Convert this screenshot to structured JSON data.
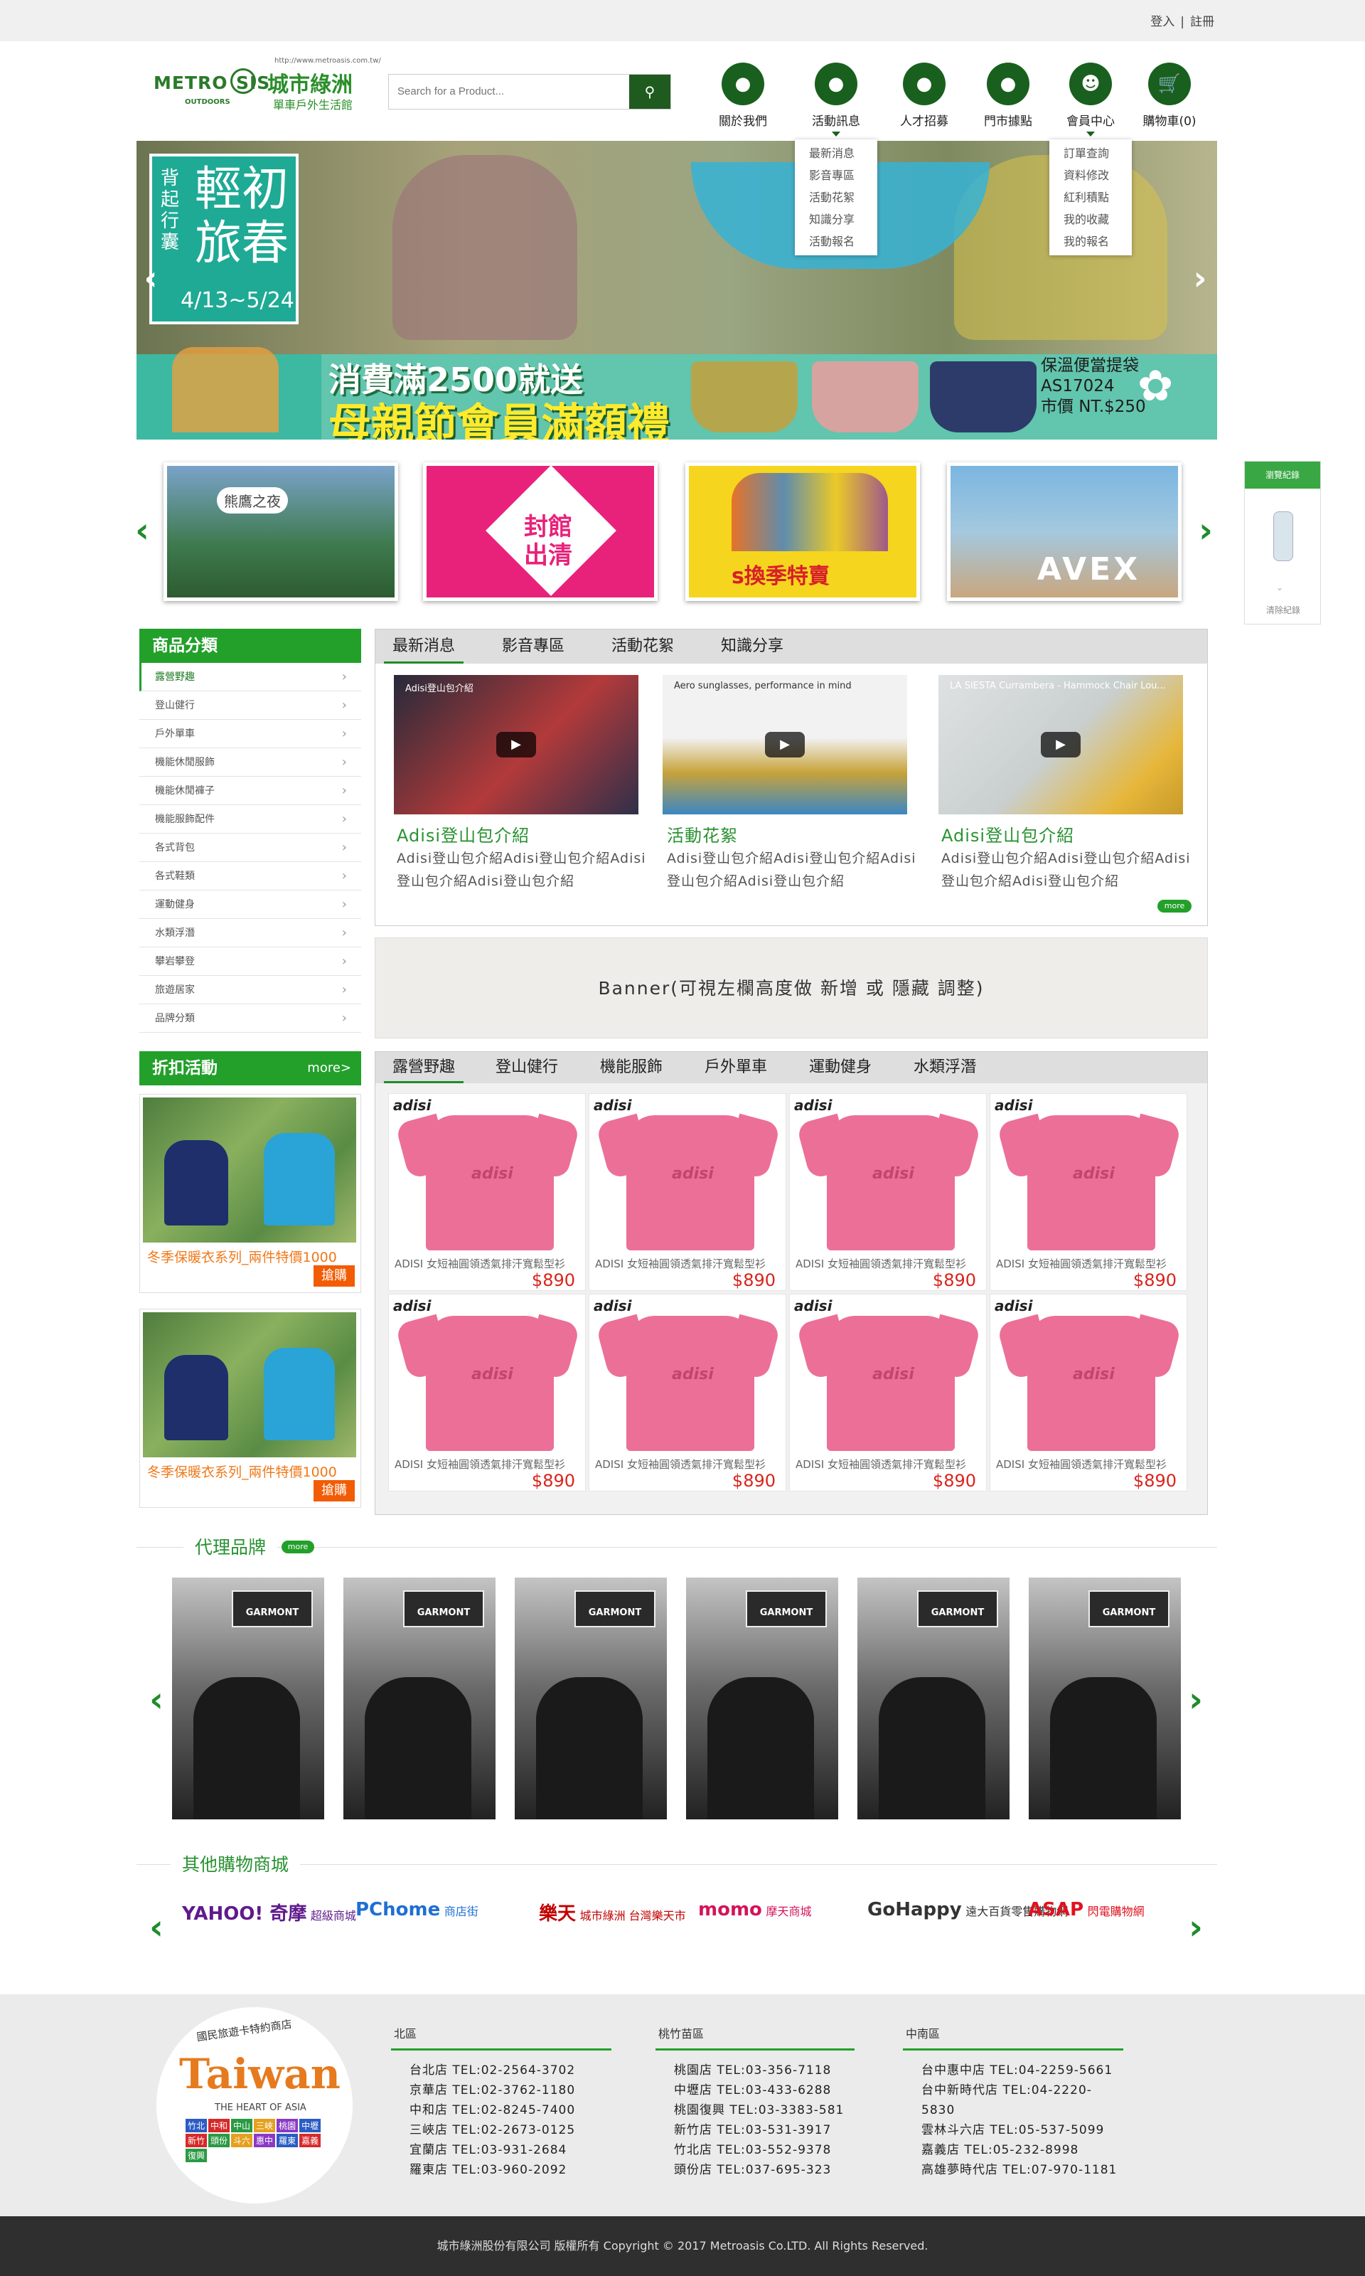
{
  "topbar": {
    "login": "登入",
    "sep": "|",
    "register": "註冊"
  },
  "logo": {
    "en": "METRO",
    "en2": "SIS",
    "outdoor": "OUTDOORS",
    "cn": "城市綠洲",
    "sub": "單車戶外生活館",
    "url": "http://www.metroasis.com.tw/"
  },
  "search": {
    "placeholder": "Search for a Product..."
  },
  "nav": [
    {
      "label": "關於我們",
      "icon": "map-pin-icon"
    },
    {
      "label": "活動訊息",
      "icon": "map-pin-icon"
    },
    {
      "label": "人才招募",
      "icon": "map-pin-icon"
    },
    {
      "label": "門市據點",
      "icon": "map-pin-icon"
    },
    {
      "label": "會員中心",
      "icon": "user-icon"
    },
    {
      "label": "購物車(0)",
      "icon": "cart-icon"
    }
  ],
  "dropdowns": {
    "activity": [
      "最新消息",
      "影音專區",
      "活動花絮",
      "知識分享",
      "活動報名"
    ],
    "member": [
      "訂單查詢",
      "資料修改",
      "紅利積點",
      "我的收藏",
      "我的報名"
    ]
  },
  "banner": {
    "vertical": "背起行囊",
    "title": "輕初旅春",
    "dates": "4/13~5/24",
    "promo1": "消費滿2500就送",
    "promo2": "母親節會員滿額禮",
    "note": [
      "保溫便當提袋",
      "AS17024",
      "市價 NT.$250"
    ]
  },
  "thumbs": [
    {
      "text": "熊鷹之夜"
    },
    {
      "text": "封館出清"
    },
    {
      "text": "s換季特賣"
    },
    {
      "text": "AVEX"
    }
  ],
  "sidewidget": {
    "title": "瀏覽紀錄",
    "clear": "清除紀錄"
  },
  "categories": {
    "title": "商品分類",
    "items": [
      "露營野趣",
      "登山健行",
      "戶外單車",
      "機能休閒服飾",
      "機能休閒褲子",
      "機能服飾配件",
      "各式背包",
      "各式鞋類",
      "運動健身",
      "水類浮潛",
      "攀岩攀登",
      "旅遊居家",
      "品牌分類"
    ]
  },
  "news": {
    "tabs": [
      "最新消息",
      "影音專區",
      "活動花絮",
      "知識分享"
    ],
    "videos": [
      {
        "vtitle": "Adisi登山包介紹",
        "title": "Adisi登山包介紹",
        "desc": "Adisi登山包介紹Adisi登山包介紹Adisi登山包介紹Adisi登山包介紹"
      },
      {
        "vtitle": "Aero sunglasses, performance in mind",
        "title": "活動花絮",
        "desc": "Adisi登山包介紹Adisi登山包介紹Adisi登山包介紹Adisi登山包介紹"
      },
      {
        "vtitle": "LA SIESTA Currambera - Hammock Chair Lou...",
        "title": "Adisi登山包介紹",
        "desc": "Adisi登山包介紹Adisi登山包介紹Adisi登山包介紹Adisi登山包介紹"
      }
    ],
    "more": "more"
  },
  "banner_placeholder": "Banner(可視左欄高度做 新增 或 隱藏 調整)",
  "discount": {
    "title": "折扣活動",
    "more": "more>",
    "cards": [
      {
        "title": "冬季保暖衣系列_兩件特價1000",
        "buy": "搶購"
      },
      {
        "title": "冬季保暖衣系列_兩件特價1000",
        "buy": "搶購"
      }
    ]
  },
  "product_tabs": [
    "露營野趣",
    "登山健行",
    "機能服飾",
    "戶外單車",
    "運動健身",
    "水類浮潛"
  ],
  "products": [
    {
      "brand": "adisi",
      "name": "ADISI 女短袖圓領透氣排汗寬鬆型衫",
      "price": "$890"
    },
    {
      "brand": "adisi",
      "name": "ADISI 女短袖圓領透氣排汗寬鬆型衫",
      "price": "$890"
    },
    {
      "brand": "adisi",
      "name": "ADISI 女短袖圓領透氣排汗寬鬆型衫",
      "price": "$890"
    },
    {
      "brand": "adisi",
      "name": "ADISI 女短袖圓領透氣排汗寬鬆型衫",
      "price": "$890"
    },
    {
      "brand": "adisi",
      "name": "ADISI 女短袖圓領透氣排汗寬鬆型衫",
      "price": "$890"
    },
    {
      "brand": "adisi",
      "name": "ADISI 女短袖圓領透氣排汗寬鬆型衫",
      "price": "$890"
    },
    {
      "brand": "adisi",
      "name": "ADISI 女短袖圓領透氣排汗寬鬆型衫",
      "price": "$890"
    },
    {
      "brand": "adisi",
      "name": "ADISI 女短袖圓領透氣排汗寬鬆型衫",
      "price": "$890"
    }
  ],
  "agent": {
    "title": "代理品牌",
    "more": "more",
    "brands": [
      "GARMONT",
      "GARMONT",
      "GARMONT",
      "GARMONT",
      "GARMONT",
      "GARMONT"
    ]
  },
  "shops": {
    "title": "其他購物商城",
    "items": [
      {
        "name": "YAHOO! 奇摩",
        "extra": "超級商城",
        "color": "#5f1a8c"
      },
      {
        "name": "PChome",
        "extra": "商店街",
        "color": "#1f6fd4"
      },
      {
        "name": "樂天",
        "extra": "城市綠洲 台灣樂天市",
        "color": "#c20000"
      },
      {
        "name": "momo",
        "extra": "摩天商城",
        "color": "#d4145a"
      },
      {
        "name": "GoHappy",
        "extra": "遠大百貨零售購物網",
        "color": "#333333"
      },
      {
        "name": "ASAP",
        "extra": "閃電購物網",
        "color": "#e0121e"
      }
    ]
  },
  "footer": {
    "logo": {
      "top": "國民旅遊卡特約商店",
      "main": "Taiwan",
      "sub": "THE HEART OF ASIA",
      "tags": [
        "竹北",
        "中和",
        "中山",
        "三峽",
        "桃園",
        "中壢",
        "新竹",
        "頭份",
        "斗六",
        "惠中",
        "羅東",
        "嘉義",
        "復興"
      ]
    },
    "regions": [
      {
        "name": "北區",
        "stores": [
          "台北店 TEL:02-2564-3702",
          "京華店 TEL:02-3762-1180",
          "中和店 TEL:02-8245-7400",
          "三峽店 TEL:02-2673-0125",
          "宜蘭店 TEL:03-931-2684",
          "羅東店 TEL:03-960-2092"
        ]
      },
      {
        "name": "桃竹苗區",
        "stores": [
          "桃園店 TEL:03-356-7118",
          "中壢店 TEL:03-433-6288",
          "桃園復興 TEL:03-3383-581",
          "新竹店 TEL:03-531-3917",
          "竹北店 TEL:03-552-9378",
          "頭份店 TEL:037-695-323"
        ]
      },
      {
        "name": "中南區",
        "stores": [
          "台中惠中店 TEL:04-2259-5661",
          "台中新時代店 TEL:04-2220-5830",
          "雲林斗六店 TEL:05-537-5099",
          "嘉義店 TEL:05-232-8998",
          "高雄夢時代店 TEL:07-970-1181"
        ]
      }
    ],
    "copyright": "城市綠洲股份有限公司 版權所有 Copyright © 2017 Metroasis Co.LTD. All Rights Reserved."
  },
  "colors": {
    "brand_green": "#22a02a",
    "dark_green": "#19601e",
    "price_red": "#d9241d",
    "orange": "#f25c05"
  }
}
